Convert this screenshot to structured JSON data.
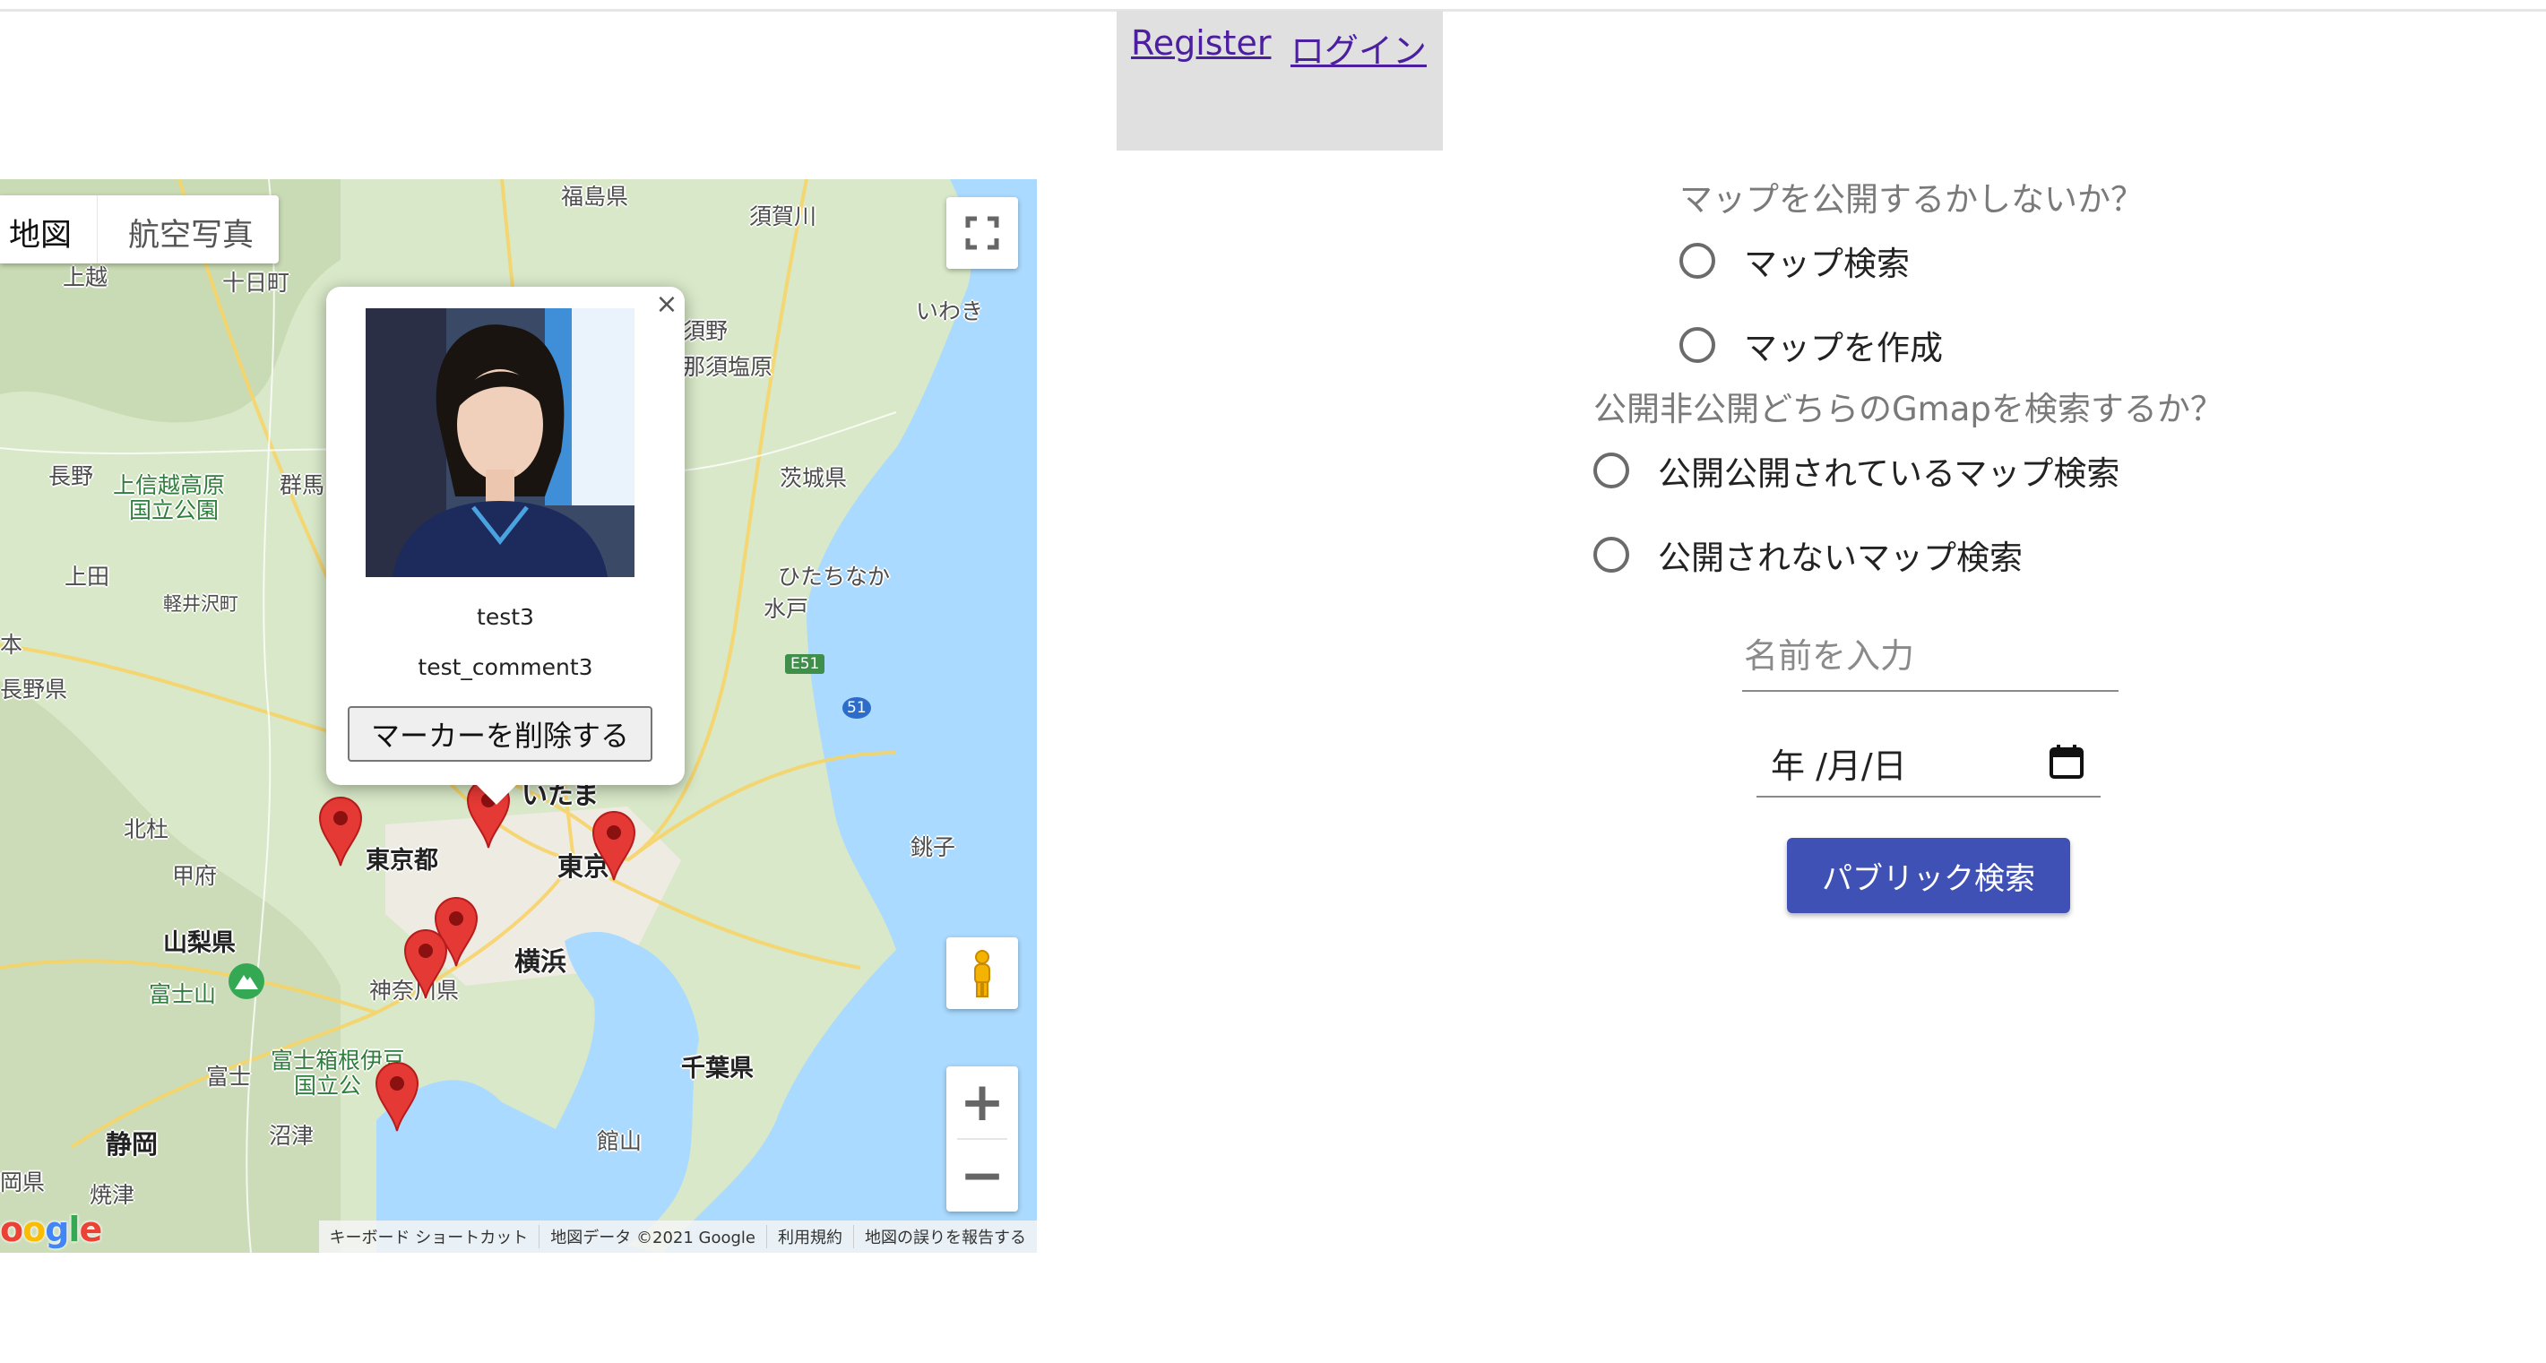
{
  "header": {
    "register_label": "Register",
    "login_label": "ログイン"
  },
  "map": {
    "map_type_labels": [
      "地図",
      "航空写真"
    ],
    "icons": {
      "fullscreen": "fullscreen-icon",
      "pegman": "pegman-icon",
      "zoom_in": "+",
      "zoom_out": "−",
      "close": "×"
    },
    "place_labels": [
      "福島県",
      "須賀川",
      "十日町",
      "上越",
      "いわき",
      "那須塩原",
      "須野",
      "長野",
      "上信越高原",
      "国立公園",
      "群馬",
      "上田",
      "軽井沢町",
      "本",
      "茨城県",
      "ひたちなか",
      "水戸",
      "長野県",
      "E51",
      "51",
      "北杜",
      "甲府",
      "東京都",
      "いたま",
      "東京",
      "銚子",
      "山梨県",
      "富士山",
      "神奈川県",
      "横浜",
      "富士箱根伊豆",
      "国立公",
      "富士",
      "千葉県",
      "静岡",
      "沼津",
      "館山",
      "岡県",
      "焼津"
    ],
    "popup": {
      "title": "test3",
      "comment": "test_comment3",
      "delete_label": "マーカーを削除する"
    },
    "footer": [
      "キーボード ショートカット",
      "地図データ ©2021 Google",
      "利用規約",
      "地図の誤りを報告する"
    ],
    "logo_text": "oogle",
    "colors": {
      "marker": "#e53935",
      "water": "#aadaff",
      "land": "#d7e6c8"
    }
  },
  "form": {
    "visibility_question": "マップを公開するかしないか？",
    "visibility_options": [
      "マップ検索",
      "マップを作成"
    ],
    "scope_question": "公開非公開どちらのGmapを検索するか？",
    "scope_options": [
      "公開公開されているマップ検索",
      "公開されないマップ検索"
    ],
    "name_placeholder": "名前を入力",
    "date_display": "年 /月/日",
    "search_button_label": "パブリック検索",
    "colors": {
      "primary": "#3f51b5"
    }
  }
}
